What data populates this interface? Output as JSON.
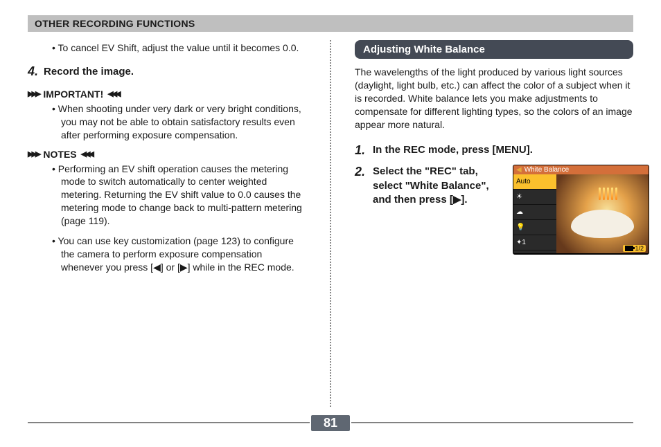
{
  "section_header": "OTHER RECORDING FUNCTIONS",
  "left": {
    "cancel_ev": "To cancel EV Shift, adjust the value until it becomes 0.0.",
    "step4_num": "4.",
    "step4_text": "Record the image.",
    "important_label": "IMPORTANT!",
    "important_bullet": "When shooting under very dark or very bright conditions, you may not be able to obtain satisfactory results even after performing exposure compensation.",
    "notes_label": "NOTES",
    "note1": "Performing an EV shift operation causes the metering mode to switch automatically to center weighted metering. Returning the EV shift value to 0.0 causes the metering mode to change back to multi-pattern metering (page 119).",
    "note2": "You can use key customization (page 123) to configure the camera to perform exposure compensation whenever you press [◀] or [▶] while in the REC mode."
  },
  "right": {
    "heading": "Adjusting White Balance",
    "intro": "The wavelengths of the light produced by various light sources (daylight, light bulb, etc.) can affect the color of a subject when it is recorded. White balance lets you make adjustments to compensate for different lighting types, so the colors of an image appear more natural.",
    "step1_num": "1.",
    "step1_text": "In the REC mode, press [MENU].",
    "step2_num": "2.",
    "step2_text": "Select the \"REC\" tab, select \"White Balance\", and then press [▶].",
    "menu": {
      "title": "White Balance",
      "options": [
        "Auto",
        "☀",
        "☁",
        "💡",
        "✦1"
      ],
      "page_indicator": "1/2"
    }
  },
  "page_number": "81"
}
